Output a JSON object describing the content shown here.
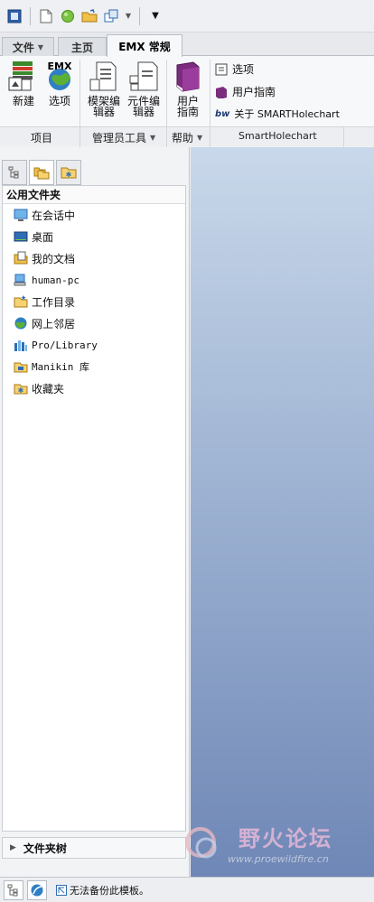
{
  "tabs": [
    {
      "label": "文件",
      "has_menu": true
    },
    {
      "label": "主页",
      "has_menu": false
    },
    {
      "label": "EMX 常规",
      "has_menu": false,
      "active": true
    }
  ],
  "ribbon": {
    "new_label": "新建",
    "options_label": "选项",
    "model_editor_label": "模架编\n辑器",
    "component_editor_label": "元件编\n辑器",
    "user_guide_label": "用户\n指南",
    "smart": {
      "options": "选项",
      "user_guide": "用户指南",
      "about": "关于 SMARTHolechart"
    },
    "emx_logo_text": "EMX",
    "bw_logo_text": "bw",
    "groups": {
      "items": "项目",
      "admin_tools": "管理员工具",
      "help": "帮助",
      "smart": "SmartHolechart"
    }
  },
  "panel": {
    "header": "公用文件夹",
    "items": [
      {
        "label": "在会话中",
        "icon": "monitor-icon"
      },
      {
        "label": "桌面",
        "icon": "desktop-icon"
      },
      {
        "label": "我的文档",
        "icon": "documents-icon"
      },
      {
        "label": "human-pc",
        "icon": "computer-icon"
      },
      {
        "label": "工作目录",
        "icon": "work-folder-icon"
      },
      {
        "label": "网上邻居",
        "icon": "network-icon"
      },
      {
        "label": "Pro/Library",
        "icon": "library-icon"
      },
      {
        "label": "Manikin 库",
        "icon": "manikin-library-icon"
      },
      {
        "label": "收藏夹",
        "icon": "favorites-icon"
      }
    ],
    "tree_label": "文件夹树"
  },
  "status": {
    "message": "无法备份此模板。"
  },
  "watermark": {
    "title": "野火论坛",
    "url": "www.proewildfire.cn"
  },
  "colors": {
    "accent": "#2f6db5",
    "main_top": "#c9d8ea",
    "main_bottom": "#6f87b6"
  }
}
